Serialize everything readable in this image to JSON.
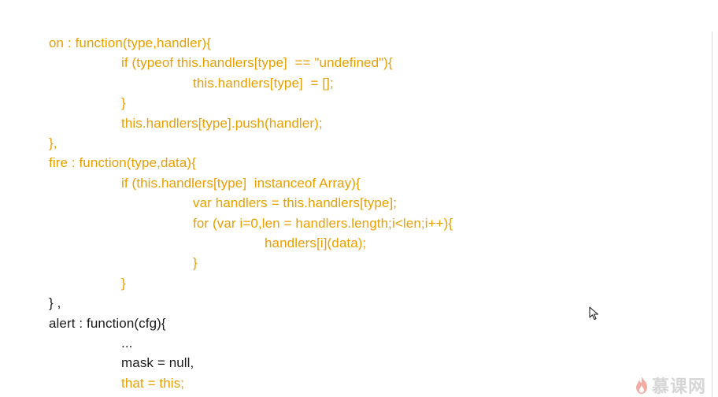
{
  "code": {
    "lines": [
      {
        "text": "on : function(type,handler){",
        "indent": 0,
        "style": "hl"
      },
      {
        "text": "if (typeof this.handlers[type]  == \"undefined\"){",
        "indent": 1,
        "style": "hl"
      },
      {
        "text": "this.handlers[type]  = [];",
        "indent": 2,
        "style": "hl"
      },
      {
        "text": "}",
        "indent": 1,
        "style": "hl"
      },
      {
        "text": "this.handlers[type].push(handler);",
        "indent": 1,
        "style": "hl"
      },
      {
        "text": "},",
        "indent": 0,
        "style": "hl"
      },
      {
        "text": "fire : function(type,data){",
        "indent": 0,
        "style": "hl"
      },
      {
        "text": "if (this.handlers[type]  instanceof Array){",
        "indent": 1,
        "style": "hl"
      },
      {
        "text": "var handlers = this.handlers[type];",
        "indent": 2,
        "style": "hl"
      },
      {
        "text": "for (var i=0,len = handlers.length;i<len;i++){",
        "indent": 2,
        "style": "hl"
      },
      {
        "text": "handlers[i](data);",
        "indent": 3,
        "style": "hl"
      },
      {
        "text": "}",
        "indent": 2,
        "style": "hl"
      },
      {
        "text": "}",
        "indent": 1,
        "style": "hl"
      },
      {
        "text": "} ,",
        "indent": 0,
        "style": "plain"
      },
      {
        "text": "alert : function(cfg){",
        "indent": 0,
        "style": "plain"
      },
      {
        "text": "...",
        "indent": 1,
        "style": "plain"
      },
      {
        "text": "mask = null,",
        "indent": 1,
        "style": "plain"
      },
      {
        "text": "that = this;",
        "indent": 1,
        "style": "hl"
      }
    ]
  },
  "watermark": {
    "text": "慕课网",
    "icon": "flame-logo-icon"
  },
  "cursor": {
    "icon": "mouse-pointer-icon"
  },
  "colors": {
    "highlight": "#e8a000",
    "plain": "#1a1a1a",
    "background": "#ffffff"
  }
}
